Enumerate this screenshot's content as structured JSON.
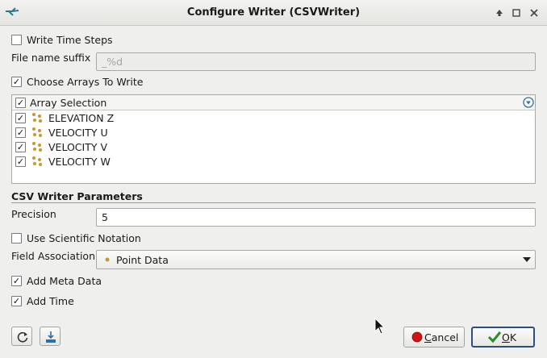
{
  "window": {
    "title": "Configure Writer (CSVWriter)",
    "controls": [
      "up-arrow-icon",
      "maximize-icon",
      "close-icon"
    ]
  },
  "write_time_steps": {
    "label": "Write Time Steps",
    "checked": false
  },
  "file_name_suffix": {
    "label": "File name suffix",
    "value": "_%d",
    "enabled": false
  },
  "choose_arrays": {
    "label": "Choose Arrays To Write",
    "checked": true
  },
  "array_selection": {
    "header": "Array Selection",
    "header_checked": true,
    "items": [
      {
        "label": "ELEVATION Z",
        "checked": true,
        "icon": "point-data-icon"
      },
      {
        "label": "VELOCITY U",
        "checked": true,
        "icon": "point-data-icon"
      },
      {
        "label": "VELOCITY V",
        "checked": true,
        "icon": "point-data-icon"
      },
      {
        "label": "VELOCITY W",
        "checked": true,
        "icon": "point-data-icon"
      }
    ]
  },
  "parameters": {
    "section_title": "CSV Writer Parameters",
    "precision": {
      "label": "Precision",
      "value": "5"
    },
    "scientific_notation": {
      "label": "Use Scientific Notation",
      "checked": false
    },
    "field_association": {
      "label": "Field Association",
      "value": "Point Data",
      "icon": "point-data-icon"
    },
    "add_meta_data": {
      "label": "Add Meta Data",
      "checked": true
    },
    "add_time": {
      "label": "Add Time",
      "checked": true
    }
  },
  "footer": {
    "tool_icons": [
      "reset-icon",
      "save-defaults-icon"
    ],
    "cancel": {
      "prefix": "C",
      "rest": "ancel"
    },
    "ok": {
      "prefix": "O",
      "rest": "K"
    }
  },
  "colors": {
    "accent": "#2f4f7a",
    "point_dots": "#c9982b",
    "cancel_red": "#d21414",
    "ok_check_green": "#2e8b2e"
  }
}
